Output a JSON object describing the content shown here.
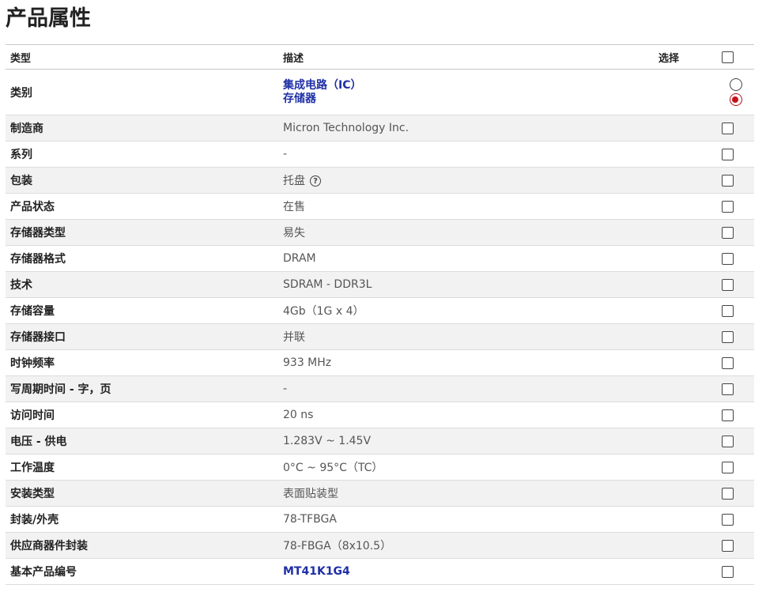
{
  "title": "产品属性",
  "header": {
    "type": "类型",
    "desc": "描述",
    "select": "选择"
  },
  "category_row": {
    "type": "类别",
    "links": [
      "集成电路（IC）",
      "存储器"
    ]
  },
  "rows": [
    {
      "type": "制造商",
      "desc": "Micron Technology Inc."
    },
    {
      "type": "系列",
      "desc": "-"
    },
    {
      "type": "包装",
      "desc": "托盘",
      "icon": "help-icon"
    },
    {
      "type": "产品状态",
      "desc": "在售"
    },
    {
      "type": "存储器类型",
      "desc": "易失"
    },
    {
      "type": "存储器格式",
      "desc": "DRAM"
    },
    {
      "type": "技术",
      "desc": "SDRAM - DDR3L"
    },
    {
      "type": "存储容量",
      "desc": "4Gb（1G x 4）"
    },
    {
      "type": "存储器接口",
      "desc": "并联"
    },
    {
      "type": "时钟频率",
      "desc": "933 MHz"
    },
    {
      "type": "写周期时间 - 字，页",
      "desc": "-"
    },
    {
      "type": "访问时间",
      "desc": "20 ns"
    },
    {
      "type": "电压 - 供电",
      "desc": "1.283V ~ 1.45V"
    },
    {
      "type": "工作温度",
      "desc": "0°C ~ 95°C（TC）"
    },
    {
      "type": "安装类型",
      "desc": "表面贴装型"
    },
    {
      "type": "封装/外壳",
      "desc": "78-TFBGA"
    },
    {
      "type": "供应商器件封装",
      "desc": "78-FBGA（8x10.5）"
    },
    {
      "type": "基本产品编号",
      "desc": "MT41K1G4",
      "link": true
    }
  ],
  "colors": {
    "link": "#1f2fa6",
    "radio_selected": "#c4121a",
    "stripe": "#f2f2f2"
  }
}
